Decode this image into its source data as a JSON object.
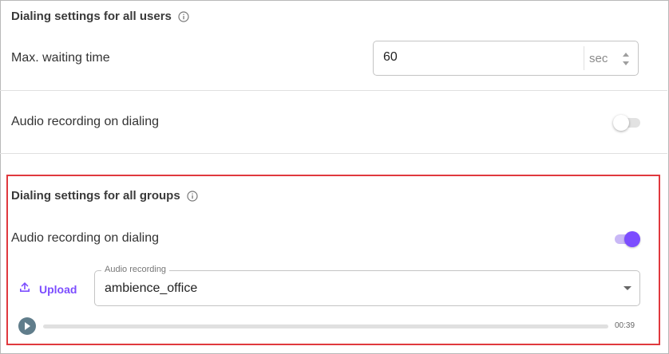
{
  "users_section": {
    "title": "Dialing settings for all users",
    "max_wait": {
      "label": "Max. waiting time",
      "value": "60",
      "unit": "sec"
    },
    "audio_recording": {
      "label": "Audio recording on dialing",
      "enabled": false
    }
  },
  "groups_section": {
    "title": "Dialing settings for all groups",
    "audio_recording": {
      "label": "Audio recording on dialing",
      "enabled": true
    },
    "upload_label": "Upload",
    "audio_select": {
      "legend": "Audio recording",
      "value": "ambience_office"
    },
    "player": {
      "duration": "00:39",
      "progress": 0
    }
  },
  "colors": {
    "accent": "#7c4dff",
    "highlight_border": "#e0393e",
    "play_button": "#607d8b"
  },
  "icons": [
    "info-icon",
    "stepper-icon",
    "upload-icon",
    "play-icon",
    "chevron-down-icon"
  ]
}
